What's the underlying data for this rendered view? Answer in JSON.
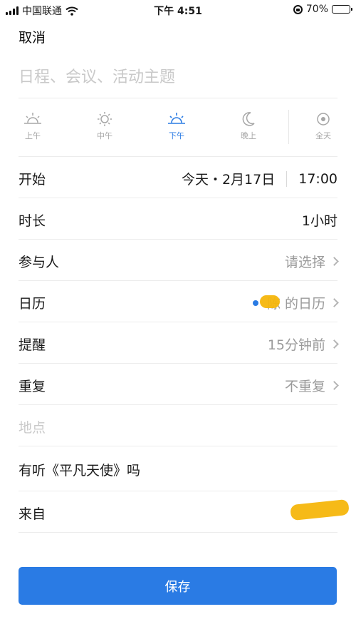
{
  "status_bar": {
    "carrier": "中国联通",
    "time": "下午 4:51",
    "battery": "70%",
    "battery_level": 0.7
  },
  "header": {
    "cancel_label": "取消"
  },
  "title_field": {
    "placeholder": "日程、会议、活动主题",
    "value": ""
  },
  "periods": [
    {
      "label": "上午",
      "icon": "sunrise-icon",
      "active": false
    },
    {
      "label": "中午",
      "icon": "sun-icon",
      "active": false
    },
    {
      "label": "下午",
      "icon": "sunset-icon",
      "active": true
    },
    {
      "label": "晚上",
      "icon": "moon-icon",
      "active": false
    },
    {
      "label": "全天",
      "icon": "all-day-icon",
      "active": false
    }
  ],
  "fields": {
    "start": {
      "label": "开始",
      "date": "今天・2月17日",
      "time": "17:00"
    },
    "duration": {
      "label": "时长",
      "value": "1小时"
    },
    "participants": {
      "label": "参与人",
      "value": "请选择"
    },
    "calendar": {
      "label": "日历",
      "value": "陈    的日历"
    },
    "reminder": {
      "label": "提醒",
      "value": "15分钟前"
    },
    "repeat": {
      "label": "重复",
      "value": "不重复"
    },
    "location": {
      "placeholder": "地点"
    },
    "note": {
      "value": "有听《平凡天使》吗"
    },
    "source": {
      "label": "来自",
      "value": ""
    }
  },
  "save_button": {
    "label": "保存"
  },
  "colors": {
    "accent": "#2a7be4",
    "redaction": "#f6b60c"
  }
}
